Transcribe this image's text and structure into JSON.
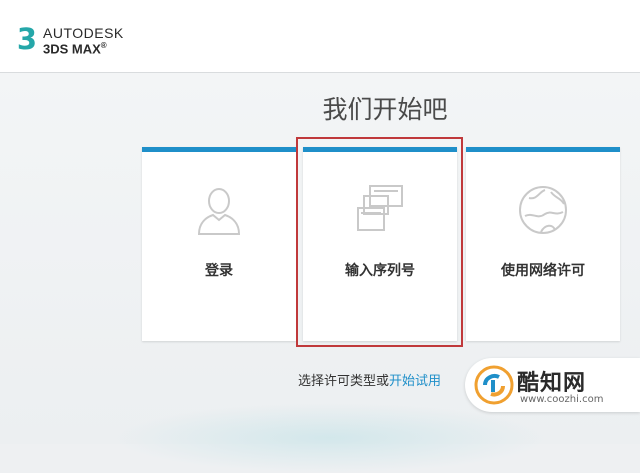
{
  "header": {
    "brand_top": "AUTODESK",
    "brand_bottom": "3DS MAX",
    "logo_mark": "3"
  },
  "main": {
    "title": "我们开始吧",
    "cards": [
      {
        "label": "登录",
        "icon": "user-icon"
      },
      {
        "label": "输入序列号",
        "icon": "serial-windows-icon"
      },
      {
        "label": "使用网络许可",
        "icon": "network-globe-icon"
      }
    ],
    "footer_text": "选择许可类型或",
    "footer_link": "开始试用"
  },
  "watermark": {
    "title": "酷知网",
    "url": "www.coozhi.com"
  },
  "colors": {
    "accent": "#1f8fc9",
    "highlight": "#c0393b",
    "logo": "#25a7a9"
  }
}
